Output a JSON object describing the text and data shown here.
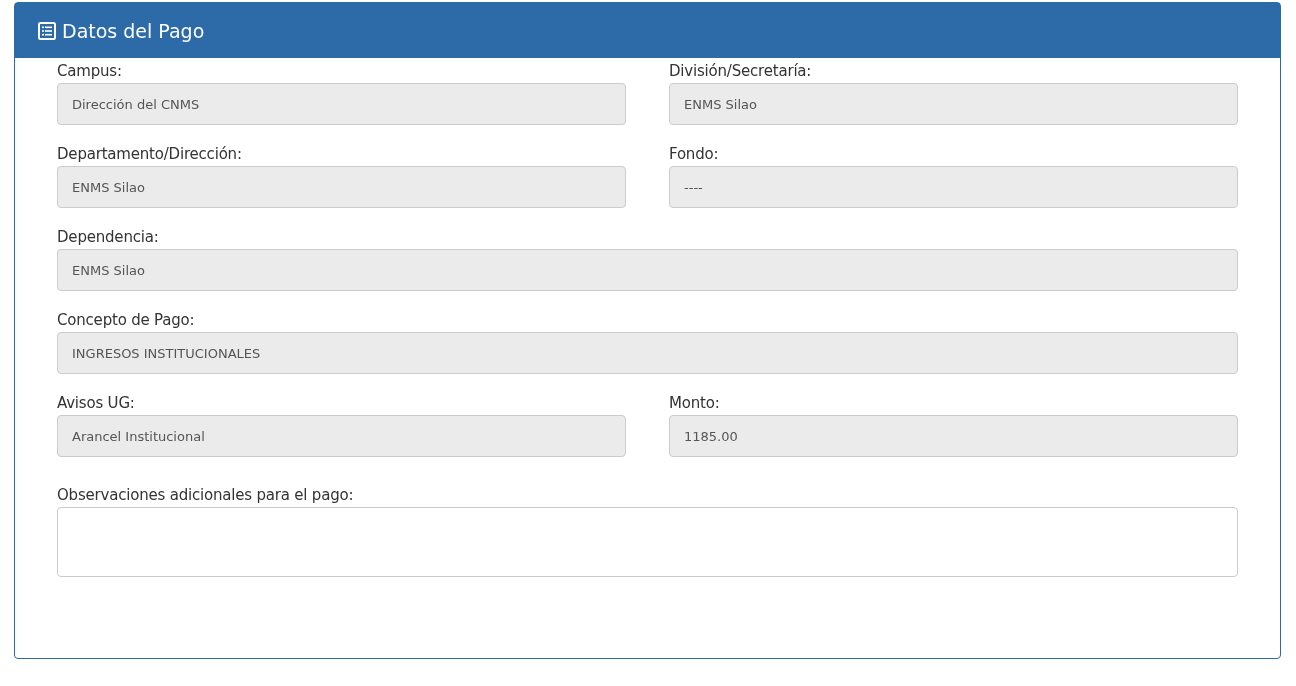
{
  "panel": {
    "title": "Datos del Pago"
  },
  "rows": [
    {
      "fields": [
        {
          "label": "Campus:",
          "value": "Dirección del CNMS",
          "kind": "readonly"
        },
        {
          "label": "División/Secretaría:",
          "value": "ENMS Silao",
          "kind": "readonly"
        }
      ]
    },
    {
      "fields": [
        {
          "label": "Departamento/Dirección:",
          "value": "ENMS Silao",
          "kind": "readonly"
        },
        {
          "label": "Fondo:",
          "value": "----",
          "kind": "readonly"
        }
      ]
    },
    {
      "fields": [
        {
          "label": "Dependencia:",
          "value": "ENMS Silao",
          "kind": "readonly"
        }
      ]
    },
    {
      "fields": [
        {
          "label": "Concepto de Pago:",
          "value": "INGRESOS INSTITUCIONALES",
          "kind": "readonly"
        }
      ]
    },
    {
      "fields": [
        {
          "label": "Avisos UG:",
          "value": "Arancel Institucional",
          "kind": "readonly"
        },
        {
          "label": "Monto:",
          "value": "1185.00",
          "kind": "readonly"
        }
      ]
    },
    {
      "fields": [
        {
          "label": "Observaciones adicionales para el pago:",
          "kind": "textarea"
        }
      ]
    }
  ]
}
